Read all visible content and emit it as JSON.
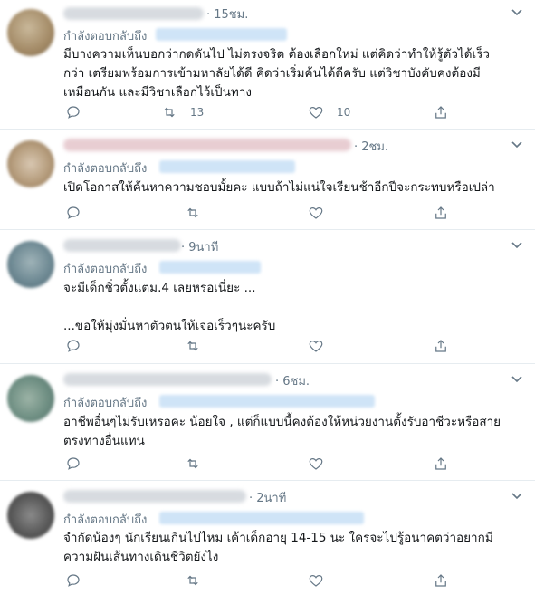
{
  "colors": {
    "text": "#14171a",
    "muted": "#657786",
    "link_blur": "#cfe4f7",
    "divider": "#e6ecf0",
    "icon": "#657786"
  },
  "icons": {
    "reply": "reply-icon",
    "retweet": "retweet-icon",
    "like": "like-icon",
    "share": "share-icon",
    "more": "chevron-down-icon"
  },
  "tweets": [
    {
      "time": "· 15ชม.",
      "replying_to": "กำลังตอบกลับถึง",
      "text": "มีบางความเห็นบอกว่ากดดันไป ไม่ตรงจริต ต้องเลือกใหม่ แต่คิดว่าทำให้รู้ตัวได้เร็ว\nกว่า เตรียมพร้อมการเข้ามหาลัยได้ดี คิดว่าเริ่มค้นได้ดีครับ แต่วิชาบังคับคงต้องมี\nเหมือนกัน และมีวิชาเลือกไว้เป็นทาง",
      "retweets": "13",
      "likes": "10"
    },
    {
      "time": "· 2ชม.",
      "replying_to": "กำลังตอบกลับถึง",
      "text": "เปิดโอกาสให้ค้นหาความชอบมั้ยคะ แบบถ้าไม่แน่ใจเรียนช้าอีกปีจะกระทบหรือเปล่า",
      "retweets": "",
      "likes": ""
    },
    {
      "time": "· 9นาที",
      "replying_to": "กำลังตอบกลับถึง",
      "text": "จะมีเด็กชิ่วตั้งแต่ม.4 เลยหรอเนี่ยะ ...\n\n...ขอให้มุ่งมั่นหาตัวตนให้เจอเร็วๆนะครับ",
      "retweets": "",
      "likes": ""
    },
    {
      "time": "· 6ชม.",
      "replying_to": "กำลังตอบกลับถึง",
      "text": "อาชีพอื่นๆไม่รับเหรอคะ น้อยใจ , แต่ก็แบบนี้คงต้องให้หน่วยงานตั้งรับอาชีวะหรือสาย\nตรงทางอื่นแทน",
      "retweets": "",
      "likes": ""
    },
    {
      "time": "· 2นาที",
      "replying_to": "กำลังตอบกลับถึง",
      "text": "จำกัดน้องๆ นักเรียนเกินไปไหม เค้าเด็กอายุ 14-15 นะ ใครจะไปรู้อนาคตว่าอยากมี\nความฝันเส้นทางเดินชีวิตยังไง",
      "retweets": "",
      "likes": ""
    }
  ]
}
